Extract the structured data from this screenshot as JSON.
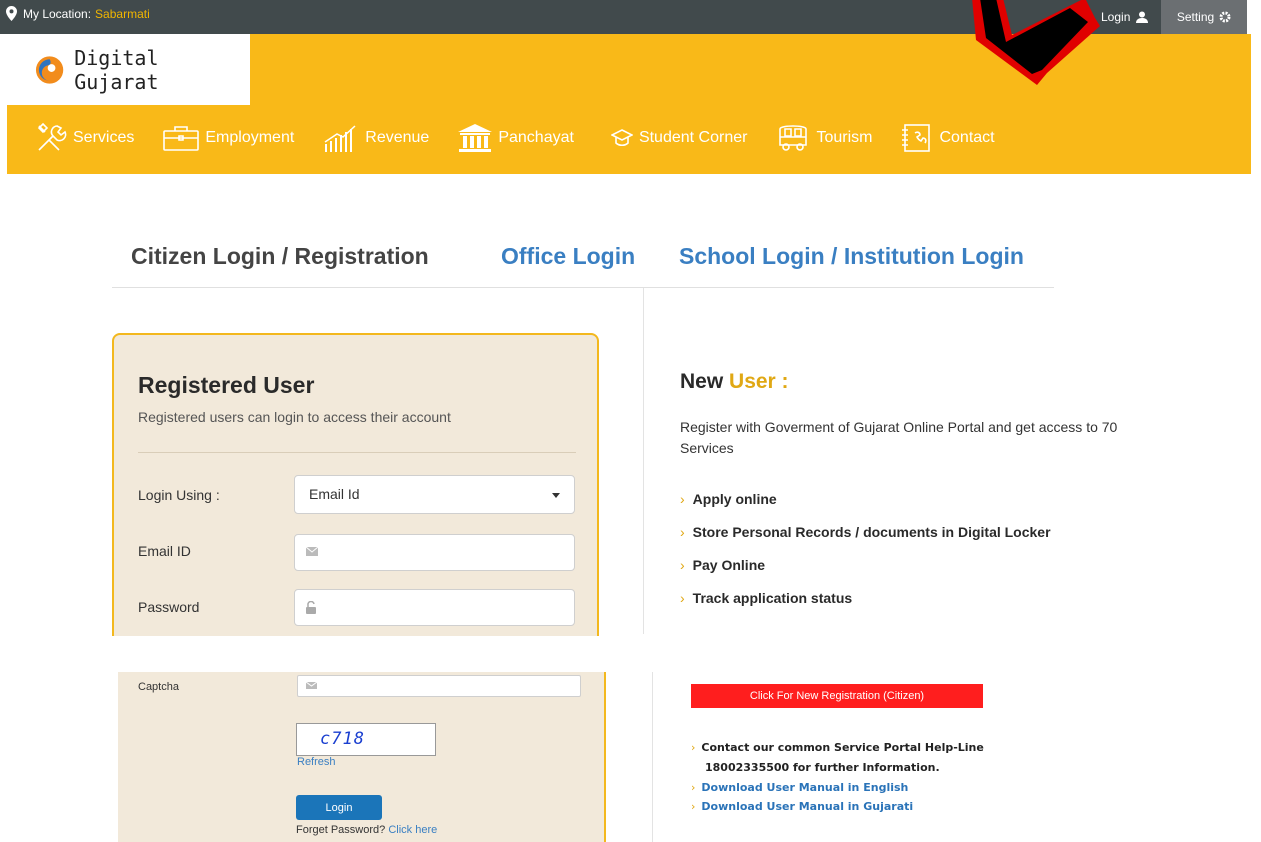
{
  "topbar": {
    "location_label": "My Location:",
    "location_value": "Sabarmati",
    "login_label": "Login",
    "setting_label": "Setting"
  },
  "brand": {
    "name": "Digital Gujarat"
  },
  "nav": {
    "items": [
      {
        "label": "Services",
        "icon": "tools-icon"
      },
      {
        "label": "Employment",
        "icon": "briefcase-icon"
      },
      {
        "label": "Revenue",
        "icon": "chart-icon"
      },
      {
        "label": "Panchayat",
        "icon": "building-icon"
      },
      {
        "label": "Student Corner",
        "icon": "graduation-cap-icon"
      },
      {
        "label": "Tourism",
        "icon": "bus-icon"
      },
      {
        "label": "Contact",
        "icon": "contact-book-icon"
      }
    ]
  },
  "tabs": {
    "citizen": "Citizen Login / Registration",
    "office": "Office Login",
    "school": "School Login / Institution Login"
  },
  "login_card": {
    "title": "Registered User",
    "subtitle": "Registered users can login to access their account",
    "login_using_label": "Login Using :",
    "login_using_value": "Email Id",
    "email_label": "Email ID",
    "password_label": "Password",
    "captcha_label": "Captcha",
    "captcha_code": "c718",
    "refresh_label": "Refresh",
    "login_button": "Login",
    "forget_text": "Forget Password?",
    "forget_link": "Click here"
  },
  "new_user": {
    "title_prefix": "New",
    "title_highlight": "User :",
    "description": "Register with Goverment of Gujarat Online Portal and get access to 70 Services",
    "features": [
      "Apply online",
      "Store Personal Records / documents in Digital Locker",
      "Pay Online",
      "Track application status"
    ],
    "register_button": "Click For New Registration (Citizen)",
    "helpline_line1": "Contact our common Service Portal Help-Line",
    "helpline_line2": "18002335500 for further Information.",
    "manual_english": "Download User Manual in English",
    "manual_gujarati": "Download User Manual in Gujarati"
  },
  "colors": {
    "header_yellow": "#f9b918",
    "topbar_dark": "#414a4c",
    "link_blue": "#3a7fc2",
    "accent_gold": "#e0a814",
    "register_red": "#ff1e1e",
    "arrow_red": "#e00000"
  }
}
